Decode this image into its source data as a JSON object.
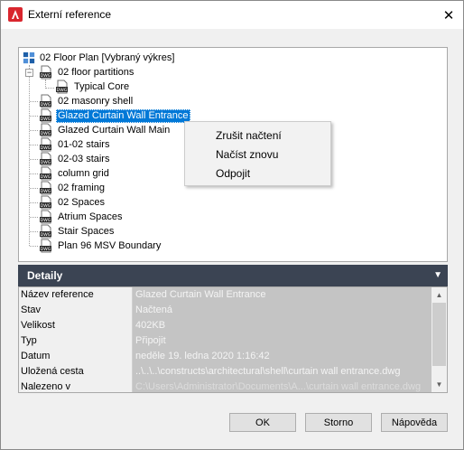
{
  "window": {
    "title": "Externí reference",
    "close_glyph": "✕"
  },
  "tree": {
    "root": "02 Floor Plan [Vybraný výkres]",
    "items": [
      {
        "label": "02 floor partitions"
      },
      {
        "label": "Typical Core"
      },
      {
        "label": "02 masonry shell"
      },
      {
        "label": "Glazed Curtain Wall Entrance"
      },
      {
        "label": "Glazed Curtain Wall Main"
      },
      {
        "label": "01-02 stairs"
      },
      {
        "label": "02-03 stairs"
      },
      {
        "label": "column grid"
      },
      {
        "label": "02 framing"
      },
      {
        "label": "02 Spaces"
      },
      {
        "label": "Atrium Spaces"
      },
      {
        "label": "Stair Spaces"
      },
      {
        "label": "Plan 96 MSV Boundary"
      }
    ],
    "expander_glyph": "−"
  },
  "context_menu": {
    "items": [
      "Zrušit načtení",
      "Načíst znovu",
      "Odpojit"
    ]
  },
  "details": {
    "title": "Detaily",
    "rows": [
      {
        "key": "Název reference",
        "value": "Glazed Curtain Wall Entrance"
      },
      {
        "key": "Stav",
        "value": "Načtená"
      },
      {
        "key": "Velikost",
        "value": "402KB"
      },
      {
        "key": "Typ",
        "value": "Připojit"
      },
      {
        "key": "Datum",
        "value": "neděle 19. ledna 2020  1:16:42"
      },
      {
        "key": "Uložená cesta",
        "value": "..\\..\\..\\constructs\\architectural\\shell\\curtain wall entrance.dwg"
      },
      {
        "key": "Nalezeno v",
        "value": "C:\\Users\\Administrator\\Documents\\A...\\curtain wall entrance.dwg"
      }
    ]
  },
  "buttons": {
    "ok": "OK",
    "cancel": "Storno",
    "help": "Nápověda"
  },
  "colors": {
    "selection": "#0078d7",
    "details_header": "#3b4453",
    "app_icon_red": "#d9262e"
  }
}
